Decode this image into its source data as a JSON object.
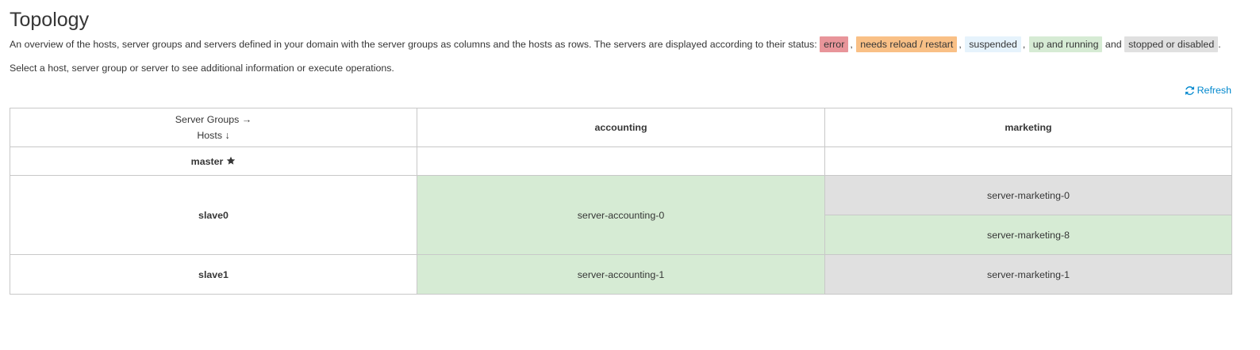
{
  "page": {
    "title": "Topology",
    "intro": "An overview of the hosts, server groups and servers defined in your domain with the server groups as columns and the hosts as rows. The servers are displayed according to their status:",
    "status_labels": {
      "error": "error",
      "reload": "needs reload / restart",
      "suspended": "suspended",
      "running": "up and running",
      "and": "and",
      "stopped": "stopped or disabled"
    },
    "separator": ",",
    "end_period": ".",
    "hint": "Select a host, server group or server to see additional information or execute operations.",
    "refresh_label": "Refresh"
  },
  "table": {
    "corner_groups": "Server Groups →",
    "corner_hosts": "Hosts ↓",
    "groups": [
      "accounting",
      "marketing"
    ],
    "hosts": [
      {
        "name": "master",
        "starred": true
      },
      {
        "name": "slave0",
        "accounting": [
          "server-accounting-0"
        ],
        "marketing": [
          "server-marketing-0",
          "server-marketing-8"
        ]
      },
      {
        "name": "slave1",
        "accounting": [
          "server-accounting-1"
        ],
        "marketing": [
          "server-marketing-1"
        ]
      }
    ],
    "status_colors": {
      "error": "#e8959a",
      "reload": "#f9c086",
      "suspended": "#e6f3fc",
      "running": "#d6ebd4",
      "stopped": "#e0e0e0"
    }
  }
}
